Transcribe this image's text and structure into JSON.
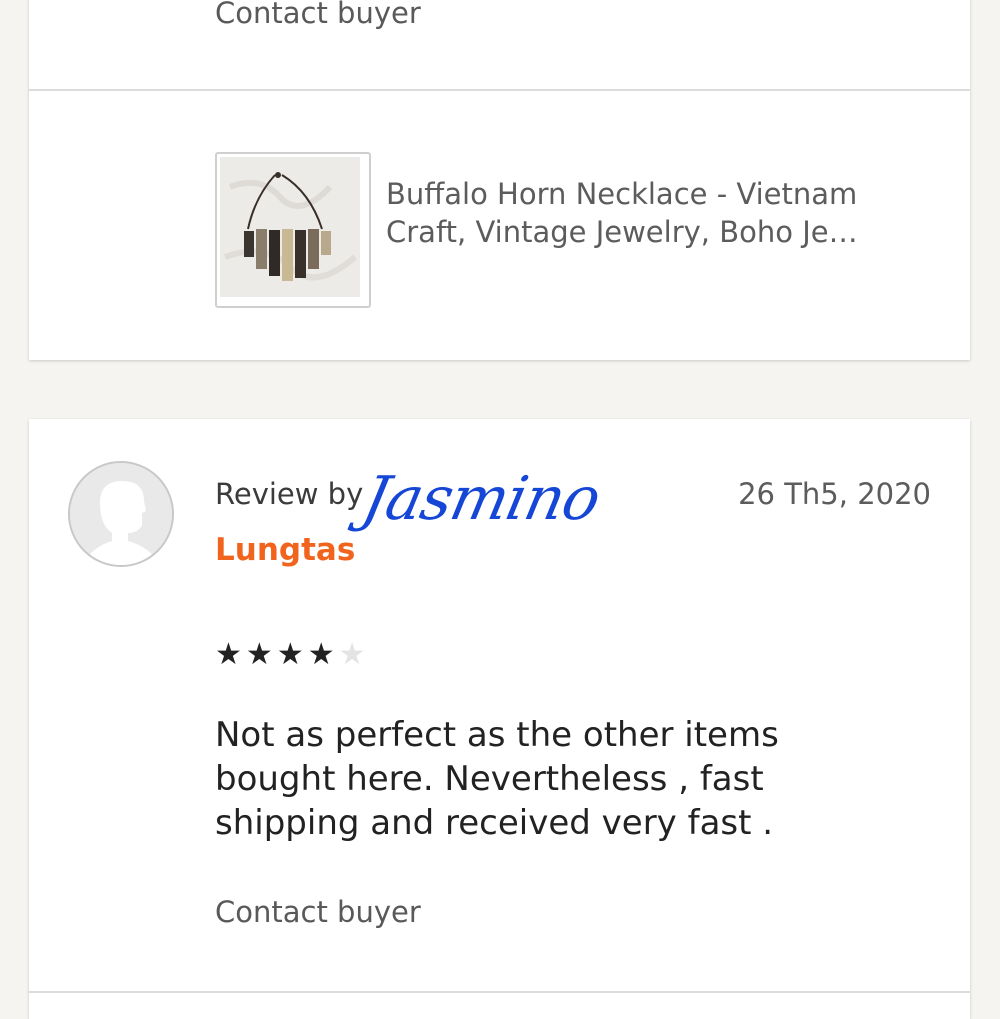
{
  "top_card": {
    "contact_label": "Contact buyer",
    "item": {
      "thumbnail_icon": "necklace-photo",
      "title_line1": "Buffalo Horn Necklace - Vietnam",
      "title_line2": "Craft, Vintage Jewelry, Boho Je…"
    }
  },
  "review": {
    "avatar_icon": "default-user-avatar",
    "review_by_label": "Review by",
    "reviewer_name": "Lungtas",
    "signature_overlay": "Jasmino",
    "date": "26 Th5, 2020",
    "rating": 4,
    "rating_max": 5,
    "text": "Not as perfect as the other items bought here. Nevertheless , fast shipping and received very fast .",
    "contact_label": "Contact buyer"
  },
  "colors": {
    "page_bg": "#f5f4f0",
    "card_bg": "#ffffff",
    "reviewer_accent": "#f1641e",
    "signature_ink": "#1546d6"
  }
}
